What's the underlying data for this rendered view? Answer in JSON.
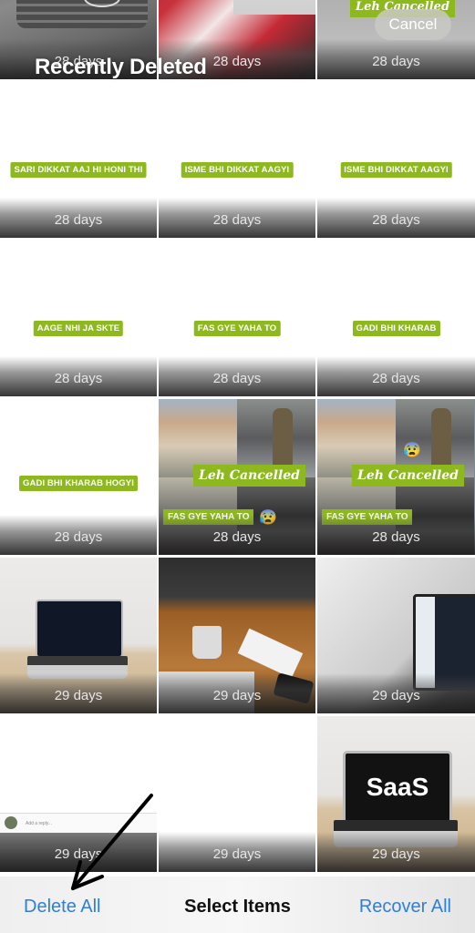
{
  "header": {
    "title": "Recently Deleted",
    "cancel_label": "Cancel"
  },
  "grid": {
    "items": [
      {
        "days": "28 days",
        "thumb": "car-grille-photo"
      },
      {
        "days": "28 days",
        "thumb": "red-scarf-photo"
      },
      {
        "days": "28 days",
        "thumb": "leh-cancelled-photo"
      },
      {
        "days": "28 days",
        "caption": "SARI DIKKAT AAJ HI HONI THI"
      },
      {
        "days": "28 days",
        "caption": "ISME BHI DIKKAT AAGYI"
      },
      {
        "days": "28 days",
        "caption": "ISME BHI DIKKAT AAGYI"
      },
      {
        "days": "28 days",
        "caption": "AAGE NHI JA SKTE"
      },
      {
        "days": "28 days",
        "caption": "FAS GYE YAHA TO"
      },
      {
        "days": "28 days",
        "caption": "GADI BHI KHARAB"
      },
      {
        "days": "28 days",
        "caption": "GADI BHI KHARAB HOGYI"
      },
      {
        "days": "28 days",
        "overlay_title": "Leh Cancelled",
        "caption": "FAS GYE YAHA TO",
        "emoji": "😰"
      },
      {
        "days": "28 days",
        "overlay_title": "Leh Cancelled",
        "caption": "FAS GYE YAHA TO",
        "emoji": "😰"
      },
      {
        "days": "29 days",
        "thumb": "laptop-desk-photo"
      },
      {
        "days": "29 days",
        "thumb": "coffee-desk-photo"
      },
      {
        "days": "29 days",
        "thumb": "code-monitor-photo"
      },
      {
        "days": "29 days",
        "thumb": "keyboard-screenshot",
        "reply_placeholder": "Add a reply..."
      },
      {
        "days": "29 days",
        "thumb": "blank"
      },
      {
        "days": "29 days",
        "thumb": "saas-laptop-photo",
        "screen_text": "SaaS"
      }
    ]
  },
  "toolbar": {
    "delete_all": "Delete All",
    "select_items": "Select Items",
    "recover_all": "Recover All"
  },
  "colors": {
    "accent": "#2f7fd6",
    "caption_green": "#8db81e"
  }
}
